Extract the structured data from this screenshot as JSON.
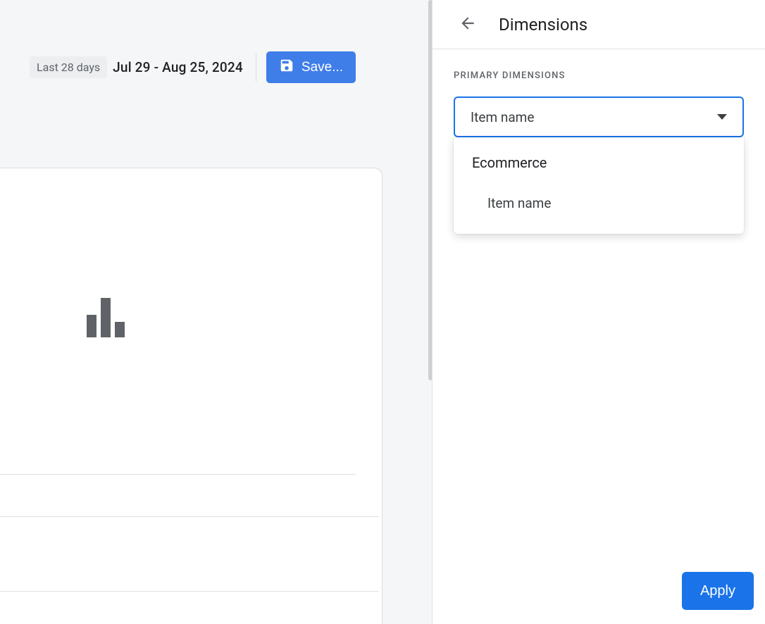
{
  "header": {
    "date_chip": "Last 28 days",
    "date_range": "Jul 29 - Aug 25, 2024",
    "save_label": "Save..."
  },
  "panel": {
    "title": "Dimensions",
    "section_label": "PRIMARY DIMENSIONS",
    "selected": "Item name",
    "dropdown": {
      "group": "Ecommerce",
      "option1": "Item name"
    },
    "apply_label": "Apply"
  }
}
